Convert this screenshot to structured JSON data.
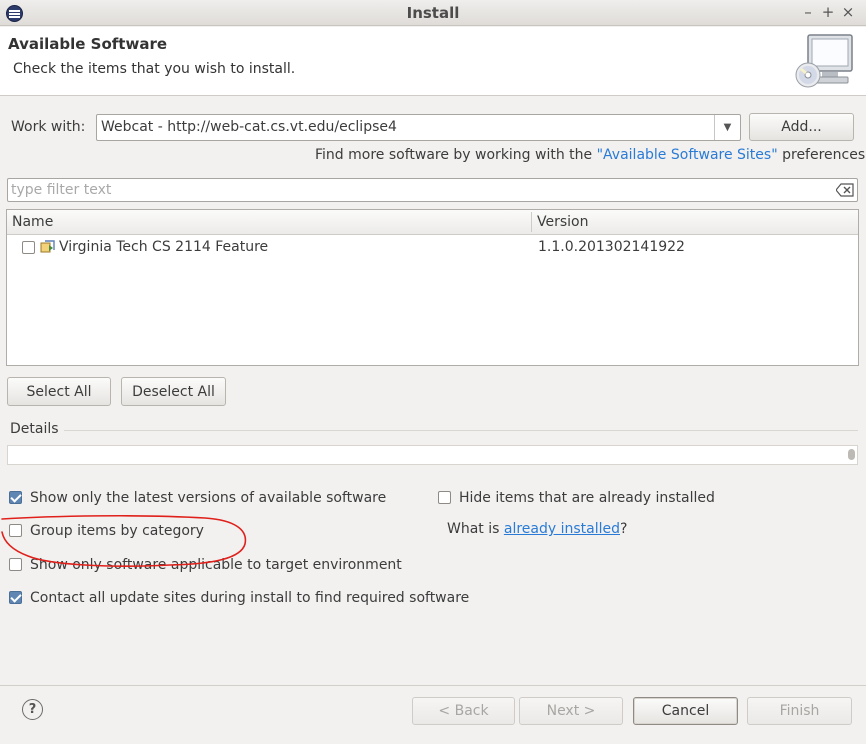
{
  "window": {
    "title": "Install",
    "controls": {
      "minimize": "–",
      "maximize": "+",
      "close": "×"
    }
  },
  "header": {
    "title": "Available Software",
    "description": "Check the items that you wish to install."
  },
  "work_with": {
    "label": "Work with:",
    "value": "Webcat - http://web-cat.cs.vt.edu/eclipse4",
    "add_button": "Add..."
  },
  "find_more": {
    "prefix": "Find more software by working with the ",
    "link": "\"Available Software Sites\"",
    "suffix": " preferences."
  },
  "filter": {
    "placeholder": "type filter text",
    "value": ""
  },
  "table": {
    "columns": [
      "Name",
      "Version"
    ],
    "rows": [
      {
        "name": "Virginia Tech CS 2114 Feature",
        "version": "1.1.0.201302141922",
        "checked": false
      }
    ]
  },
  "selection_buttons": {
    "select_all": "Select All",
    "deselect_all": "Deselect All"
  },
  "details": {
    "label": "Details",
    "text": ""
  },
  "options": {
    "show_latest": {
      "label": "Show only the latest versions of available software",
      "checked": true
    },
    "hide_installed": {
      "label": "Hide items that are already installed",
      "checked": false
    },
    "group_by_category": {
      "label": "Group items by category",
      "checked": false
    },
    "what_is_prefix": "What is ",
    "what_is_link": "already installed",
    "what_is_suffix": "?",
    "show_applicable": {
      "label": "Show only software applicable to target environment",
      "checked": false
    },
    "contact_sites": {
      "label": "Contact all update sites during install to find required software",
      "checked": true
    }
  },
  "footer": {
    "help_icon": "?",
    "back": "< Back",
    "next": "Next >",
    "cancel": "Cancel",
    "finish": "Finish"
  },
  "colors": {
    "link": "#2a7bd6",
    "annotation": "#e0201a",
    "checkbox_checked": "#5f86b3"
  }
}
